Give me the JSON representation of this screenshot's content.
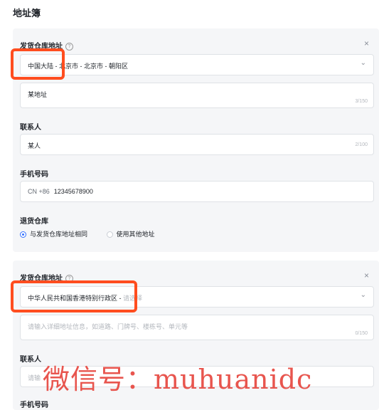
{
  "page": {
    "title": "地址簿"
  },
  "card1": {
    "warehouse_label": "发货仓库地址",
    "help_icon": "?",
    "close_icon": "×",
    "region_value": "中国大陆 - 北京市 - 北京市 - 朝阳区",
    "address_value": "某地址",
    "address_count": "3/150",
    "contact_label": "联系人",
    "contact_value": "某人",
    "contact_count": "2/100",
    "phone_label": "手机号码",
    "phone_code": "CN +86",
    "phone_value": "12345678900",
    "return_label": "退货仓库",
    "return_options": [
      "与发货仓库地址相同",
      "使用其他地址"
    ]
  },
  "card2": {
    "warehouse_label": "发货仓库地址",
    "help_icon": "?",
    "close_icon": "×",
    "region_value": "中华人民共和国香港特别行政区 -",
    "region_placeholder": "请选择",
    "address_placeholder": "请输入详细地址信息，如道路、门牌号、楼栋号、单元等",
    "address_count": "0/150",
    "contact_label": "联系人",
    "contact_placeholder": "请输",
    "phone_label": "手机号码"
  },
  "watermark": "微信号：muhuanidc",
  "colors": {
    "highlight": "#ff4d1f",
    "accent": "#3370ff",
    "watermark": "#e8554e"
  }
}
